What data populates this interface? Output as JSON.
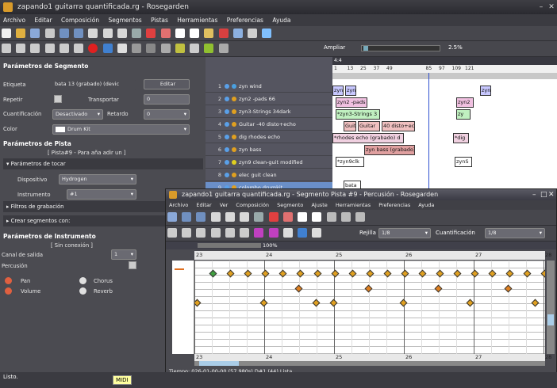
{
  "main_window": {
    "title": "zapando1 guitarra quantificada.rg - Rosegarden",
    "menu": [
      "Archivo",
      "Editar",
      "Composición",
      "Segmentos",
      "Pistas",
      "Herramientas",
      "Preferencias",
      "Ayuda"
    ],
    "zoom_label": "Ampliar",
    "zoom_value": "2.5%"
  },
  "segment_params": {
    "heading": "Parámetros de Segmento",
    "label_label": "Etiqueta",
    "label_value": "bata 13 (grabado) (devic",
    "edit_button": "Editar",
    "repeat_label": "Repetir",
    "transpose_label": "Transportar",
    "transpose_value": "0",
    "quantize_label": "Cuantificación",
    "quantize_value": "Desactivado",
    "delay_label": "Retardo",
    "delay_value": "0",
    "color_label": "Color",
    "color_value": "Drum Kit"
  },
  "track_params": {
    "heading": "Parámetros de Pista",
    "subtitle": "[ Pista#9 - Para aña adir un ]",
    "play_section": "Parámetros de tocar",
    "device_label": "Dispositivo",
    "device_value": "Hydrogen",
    "instrument_label": "Instrumento",
    "instrument_value": "#1",
    "record_filters": "Filtros de grabación",
    "create_segments": "Crear segmentos con:"
  },
  "instrument_params": {
    "heading": "Parámetros de Instrumento",
    "connection": "[ Sin conexión ]",
    "out_channel_label": "Canal de salida",
    "out_channel_value": "1",
    "percussion_label": "Percusión",
    "pan_label": "Pan",
    "chorus_label": "Chorus",
    "volume_label": "Volume",
    "reverb_label": "Reverb"
  },
  "tracks": [
    {
      "n": "1",
      "name": "zyn wind",
      "c": "#4aa0e0"
    },
    {
      "n": "2",
      "name": "zyn2 -pads 66",
      "c": "#e0a020"
    },
    {
      "n": "3",
      "name": "zyn3-Strings 34dark",
      "c": "#e0a020"
    },
    {
      "n": "4",
      "name": "Guitar -40 disto+echo",
      "c": "#e0a020"
    },
    {
      "n": "5",
      "name": "dig rhodes echo",
      "c": "#e0a020"
    },
    {
      "n": "6",
      "name": "zyn bass",
      "c": "#e0a020"
    },
    {
      "n": "7",
      "name": "zyn9 clean-guit modified",
      "c": "#e0d020"
    },
    {
      "n": "8",
      "name": "elec guit clean",
      "c": "#e0a020"
    },
    {
      "n": "9",
      "name": "colombo drumkit",
      "c": "#e0a020"
    }
  ],
  "ruler": {
    "top": "4:4",
    "marks": [
      "1",
      "13",
      "25",
      "37",
      "49",
      "",
      "",
      "85",
      "97",
      "109",
      "121"
    ]
  },
  "segments": [
    "zyn",
    "zyn",
    "zyn",
    "zyn2 -pads",
    "zyn2",
    "*zyn3-Strings 3",
    "zy",
    "Guit",
    "Guitar",
    "40 disto+echo",
    "*rhodes echo (grabado) d",
    "*dig",
    "zyn bass (grabado)",
    "*zyn9clk",
    "zynS",
    "bata"
  ],
  "perc_window": {
    "title": "zapando1 guitarra quantificada.rg - Segmento Pista #9 - Percusión - Rosegarden",
    "menu": [
      "Archivo",
      "Editar",
      "Ver",
      "Composición",
      "Segmento",
      "Ajuste",
      "Herramientas",
      "Preferencias",
      "Ayuda"
    ],
    "zoom": "100%",
    "grid_label": "Rejilla",
    "grid_value": "1/8",
    "quant_label": "Cuantificación",
    "quant_value": "1/8",
    "bars": [
      "23",
      "24",
      "25",
      "26",
      "27",
      "28"
    ],
    "status": "Tiempo: 026-01-00-00 (57.980s)  D#1 (44)   Lista."
  },
  "status": {
    "text": "Listo.",
    "midi": "MIDI"
  }
}
